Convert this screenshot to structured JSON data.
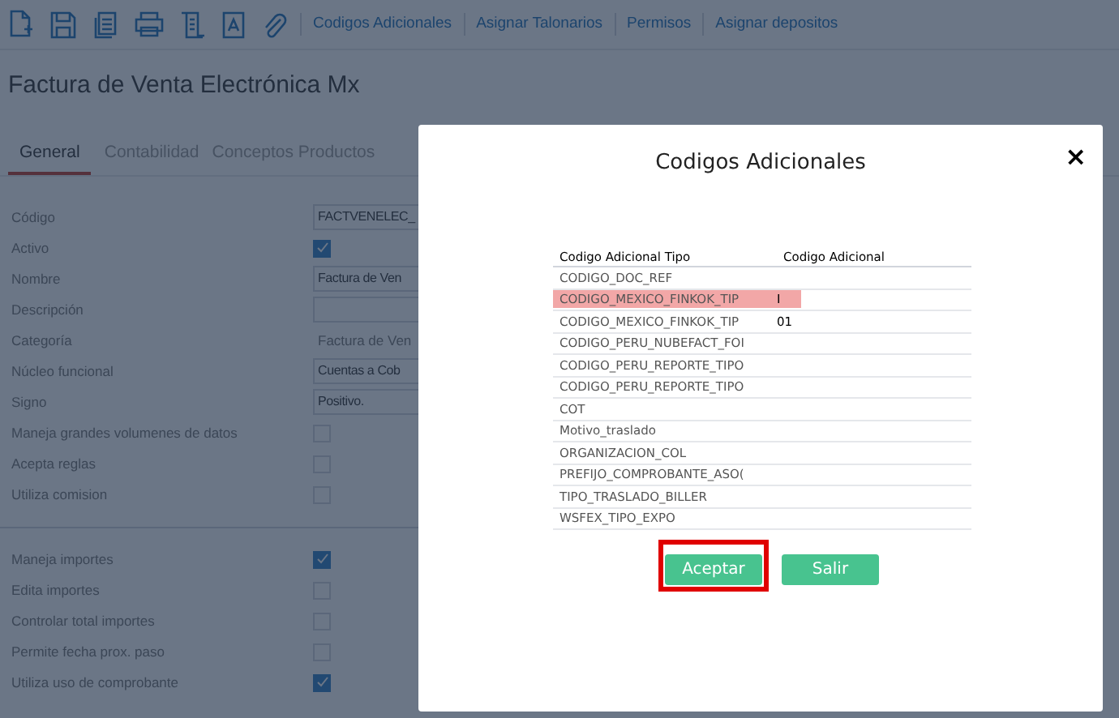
{
  "toolbar": {
    "links": [
      "Codigos Adicionales",
      "Asignar Talonarios",
      "Permisos",
      "Asignar depositos"
    ]
  },
  "page_title": "Factura de Venta Electrónica Mx",
  "tabs": [
    {
      "label": "General",
      "selected": true
    },
    {
      "label": "Contabilidad",
      "selected": false
    },
    {
      "label": "Conceptos Productos",
      "selected": false
    }
  ],
  "form": {
    "fields": [
      {
        "label": "Código",
        "kind": "input",
        "value": "FACTVENELEC_"
      },
      {
        "label": "Activo",
        "kind": "checkbox",
        "checked": true
      },
      {
        "label": "Nombre",
        "kind": "input",
        "value": "Factura de Ven"
      },
      {
        "label": "Descripción",
        "kind": "input"
      },
      {
        "label": "Categoría",
        "kind": "text",
        "value": "Factura de Ven"
      },
      {
        "label": "Núcleo funcional",
        "kind": "input",
        "value": "Cuentas a Cob"
      },
      {
        "label": "Signo",
        "kind": "select",
        "value": "Positivo."
      },
      {
        "label": "Maneja grandes volumenes de datos",
        "kind": "checkbox",
        "checked": false
      },
      {
        "label": "Acepta reglas",
        "kind": "checkbox",
        "checked": false
      },
      {
        "label": "Utiliza comision",
        "kind": "checkbox",
        "checked": false
      },
      {
        "kind": "divider"
      },
      {
        "label": "Maneja importes",
        "kind": "checkbox",
        "checked": true
      },
      {
        "label": "Edita importes",
        "kind": "checkbox",
        "checked": false
      },
      {
        "label": "Controlar total importes",
        "kind": "checkbox",
        "checked": false
      },
      {
        "label": "Permite fecha prox. paso",
        "kind": "checkbox",
        "checked": false
      },
      {
        "label": "Utiliza uso de comprobante",
        "kind": "checkbox",
        "checked": true
      }
    ]
  },
  "dialog": {
    "title": "Codigos Adicionales",
    "close": "×",
    "table": {
      "columns": [
        "Codigo Adicional Tipo",
        "Codigo Adicional"
      ],
      "rows": [
        {
          "cells": [
            "CODIGO_DOC_REF",
            ""
          ],
          "selected": false
        },
        {
          "cells": [
            "CODIGO_MEXICO_FINKOK_TIP",
            "I"
          ],
          "selected": true
        },
        {
          "cells": [
            "CODIGO_MEXICO_FINKOK_TIP",
            "01"
          ],
          "selected": false
        },
        {
          "cells": [
            "CODIGO_PERU_NUBEFACT_FOI",
            ""
          ],
          "selected": false
        },
        {
          "cells": [
            "CODIGO_PERU_REPORTE_TIPO",
            ""
          ],
          "selected": false
        },
        {
          "cells": [
            "CODIGO_PERU_REPORTE_TIPO",
            ""
          ],
          "selected": false
        },
        {
          "cells": [
            "COT",
            ""
          ],
          "selected": false
        },
        {
          "cells": [
            "Motivo_traslado",
            ""
          ],
          "selected": false
        },
        {
          "cells": [
            "ORGANIZACION_COL",
            ""
          ],
          "selected": false
        },
        {
          "cells": [
            "PREFIJO_COMPROBANTE_ASO(",
            ""
          ],
          "selected": false
        },
        {
          "cells": [
            "TIPO_TRASLADO_BILLER",
            ""
          ],
          "selected": false
        },
        {
          "cells": [
            "WSFEX_TIPO_EXPO",
            ""
          ],
          "selected": false
        }
      ]
    },
    "buttons": [
      {
        "label": "Aceptar",
        "focused": true
      },
      {
        "label": "Salir",
        "focused": false
      }
    ]
  }
}
